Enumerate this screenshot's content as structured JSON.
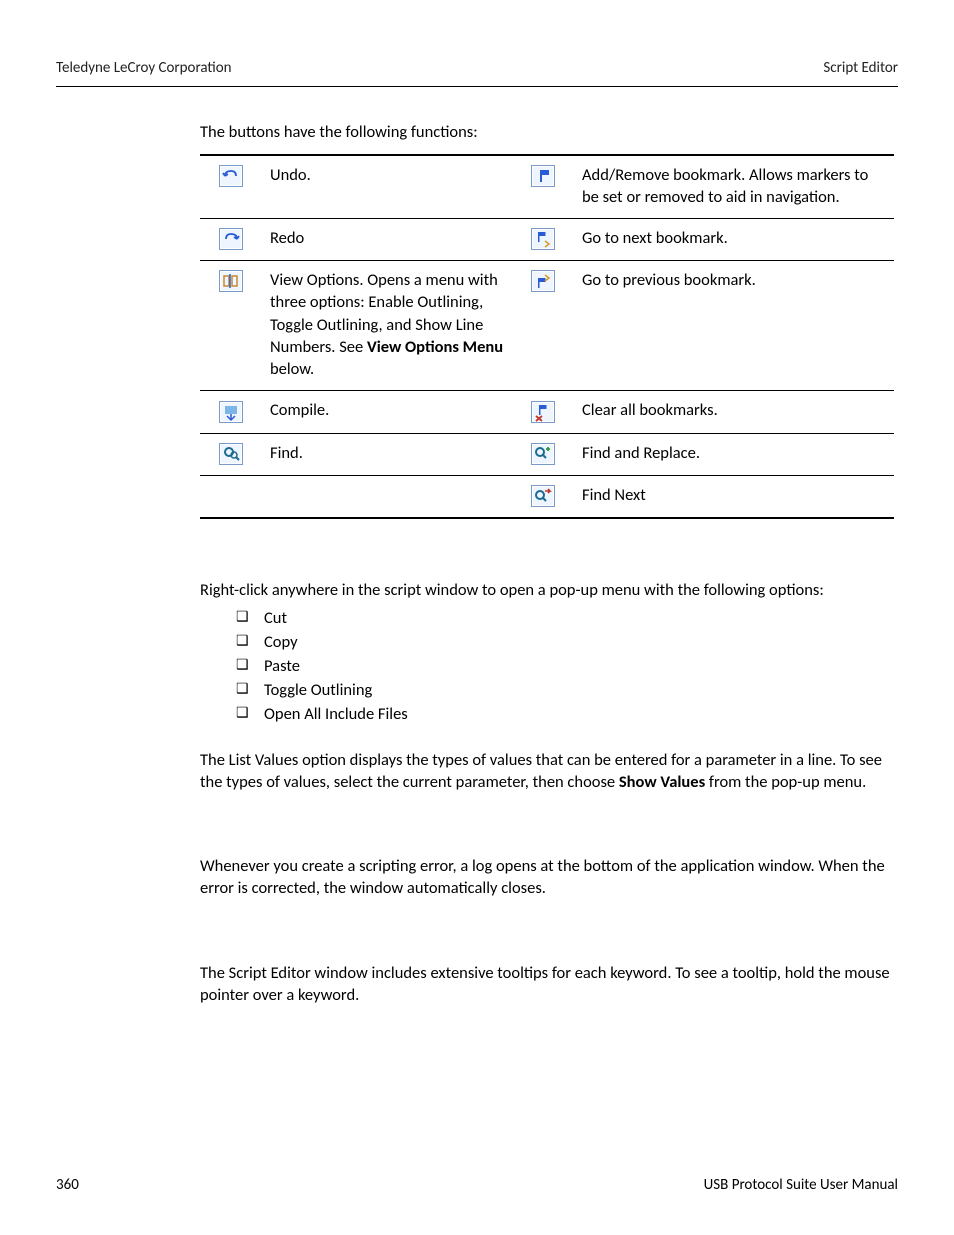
{
  "header": {
    "left": "Teledyne LeCroy Corporation",
    "right": "Script Editor"
  },
  "intro": "The buttons have the following functions:",
  "table": {
    "rows": [
      {
        "icon_left": "undo-icon",
        "desc_left": "Undo.",
        "icon_right": "bookmark-toggle-icon",
        "desc_right": "Add/Remove bookmark. Allows markers to be set or removed to aid in navigation."
      },
      {
        "icon_left": "redo-icon",
        "desc_left": "Redo",
        "icon_right": "bookmark-next-icon",
        "desc_right": "Go to next bookmark."
      },
      {
        "icon_left": "view-options-icon",
        "desc_left_pre": "View Options. Opens a menu with three options: Enable Outlining, Toggle Outlining, and Show Line Numbers. See ",
        "desc_left_bold": "View Options Menu",
        "desc_left_post": " below.",
        "icon_right": "bookmark-prev-icon",
        "desc_right": "Go to previous bookmark."
      },
      {
        "icon_left": "compile-icon",
        "desc_left": "Compile.",
        "icon_right": "bookmark-clear-icon",
        "desc_right": "Clear all bookmarks."
      },
      {
        "icon_left": "find-icon",
        "desc_left": "Find.",
        "icon_right": "find-replace-icon",
        "desc_right": "Find and Replace."
      },
      {
        "icon_left": "",
        "desc_left": "",
        "icon_right": "find-next-icon",
        "desc_right": "Find Next"
      }
    ]
  },
  "paragraphs": {
    "popup_intro": "Right-click anywhere in the script window to open a pop-up menu with the following options:",
    "popup_items": [
      "Cut",
      "Copy",
      "Paste",
      "Toggle Outlining",
      "Open All Include Files"
    ],
    "list_values_pre": "The List Values option displays the types of values that can be entered for a parameter in a line. To see the types of values, select the current parameter, then choose ",
    "list_values_bold": "Show Values",
    "list_values_post": " from the pop-up menu.",
    "error_log": "Whenever you create a scripting error, a log opens at the bottom of the application window. When the error is corrected, the window automatically closes.",
    "tooltips": "The Script Editor window includes extensive tooltips for each keyword. To see a tooltip, hold the mouse pointer over a keyword."
  },
  "footer": {
    "page": "360",
    "manual": "USB Protocol Suite User Manual"
  },
  "icons": {
    "undo-icon": "undo",
    "redo-icon": "redo",
    "view-options-icon": "view",
    "compile-icon": "compile",
    "find-icon": "find",
    "bookmark-toggle-icon": "flag",
    "bookmark-next-icon": "flag-down",
    "bookmark-prev-icon": "flag-up",
    "bookmark-clear-icon": "flag-x",
    "find-replace-icon": "find-plus",
    "find-next-icon": "find-arrow"
  }
}
